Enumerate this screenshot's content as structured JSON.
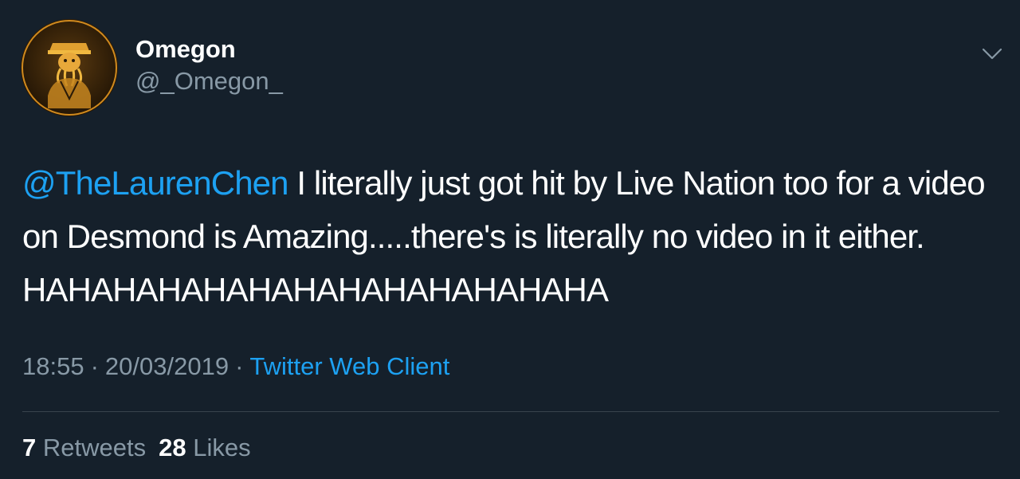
{
  "user": {
    "display_name": "Omegon",
    "handle": "@_Omegon_"
  },
  "menu": {
    "icon": "chevron-down-icon"
  },
  "tweet": {
    "mention": "@TheLaurenChen",
    "text": " I literally just got hit by Live Nation too for a video on Desmond is Amazing.....there's is literally no video in it either. HAHAHAHAHAHAHAHAHAHAHAHAHA",
    "time": "18:55",
    "date": "20/03/2019",
    "separator": "·",
    "source": "Twitter Web Client"
  },
  "stats": {
    "retweets_count": "7",
    "retweets_label": "Retweets",
    "likes_count": "28",
    "likes_label": "Likes"
  },
  "colors": {
    "background": "#15202b",
    "accent": "#1da1f2",
    "secondary_text": "#8899a6",
    "divider": "#38444d"
  }
}
